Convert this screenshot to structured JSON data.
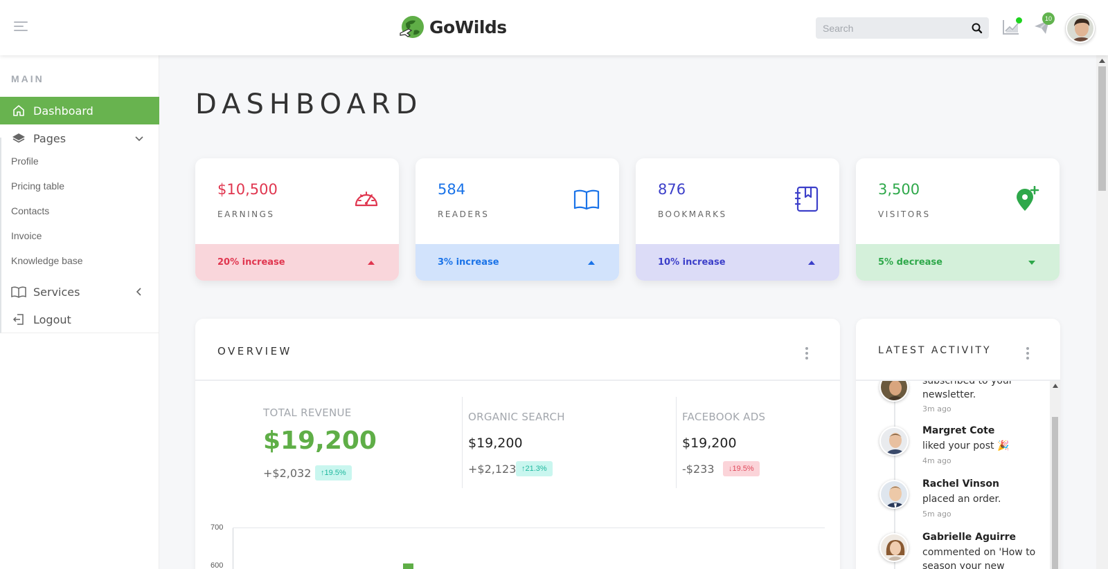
{
  "header": {
    "brand": "GoWilds",
    "search_placeholder": "Search",
    "notification_count": "10"
  },
  "sidebar": {
    "section_label": "MAIN",
    "items": [
      {
        "label": "Dashboard",
        "icon": "home-icon",
        "active": true
      },
      {
        "label": "Pages",
        "icon": "layers-icon"
      },
      {
        "label": "Services",
        "icon": "book-open-icon"
      },
      {
        "label": "Logout",
        "icon": "logout-icon"
      }
    ],
    "sub_items": [
      "Profile",
      "Pricing table",
      "Contacts",
      "Invoice",
      "Knowledge base"
    ]
  },
  "page": {
    "title": "DASHBOARD"
  },
  "stats": [
    {
      "value": "$10,500",
      "label": "EARNINGS",
      "footer": "20% increase",
      "icon": "speedometer-icon",
      "color": "#e0364f",
      "bg": "#f9d6db",
      "trend": "up"
    },
    {
      "value": "584",
      "label": "READERS",
      "footer": "3% increase",
      "icon": "open-book-icon",
      "color": "#1a73e8",
      "bg": "#d2e3fc",
      "trend": "up"
    },
    {
      "value": "876",
      "label": "BOOKMARKS",
      "footer": "10% increase",
      "icon": "notebook-bookmark-icon",
      "color": "#3c3fc9",
      "bg": "#dcdcf7",
      "trend": "up"
    },
    {
      "value": "3,500",
      "label": "VISITORS",
      "footer": "5% decrease",
      "icon": "location-add-icon",
      "color": "#2ea84a",
      "bg": "#d4f0da",
      "trend": "down"
    }
  ],
  "overview": {
    "title": "OVERVIEW",
    "metrics": [
      {
        "label": "TOTAL REVENUE",
        "value": "$19,200",
        "delta": "+$2,032",
        "pct": "↑19.5%",
        "trend": "up"
      },
      {
        "label": "ORGANIC SEARCH",
        "value": "$19,200",
        "delta": "+$2,123",
        "pct": "↑21.3%",
        "trend": "up"
      },
      {
        "label": "FACEBOOK ADS",
        "value": "$19,200",
        "delta": "-$233",
        "pct": "↓19.5%",
        "trend": "down"
      }
    ],
    "chart_ticks": [
      "700",
      "600"
    ]
  },
  "activity": {
    "title": "LATEST ACTIVITY",
    "items": [
      {
        "name": "",
        "text": "subscribed to your newsletter.",
        "time": "3m ago"
      },
      {
        "name": "Margret Cote",
        "text": "liked your post 🎉",
        "time": "4m ago"
      },
      {
        "name": "Rachel Vinson",
        "text": "placed an order.",
        "time": "5m ago"
      },
      {
        "name": "Gabrielle Aguirre",
        "text": "commented on 'How to season your new",
        "time": ""
      }
    ]
  },
  "colors": {
    "brand_green": "#68b34f",
    "accent_green": "#5fae47"
  }
}
